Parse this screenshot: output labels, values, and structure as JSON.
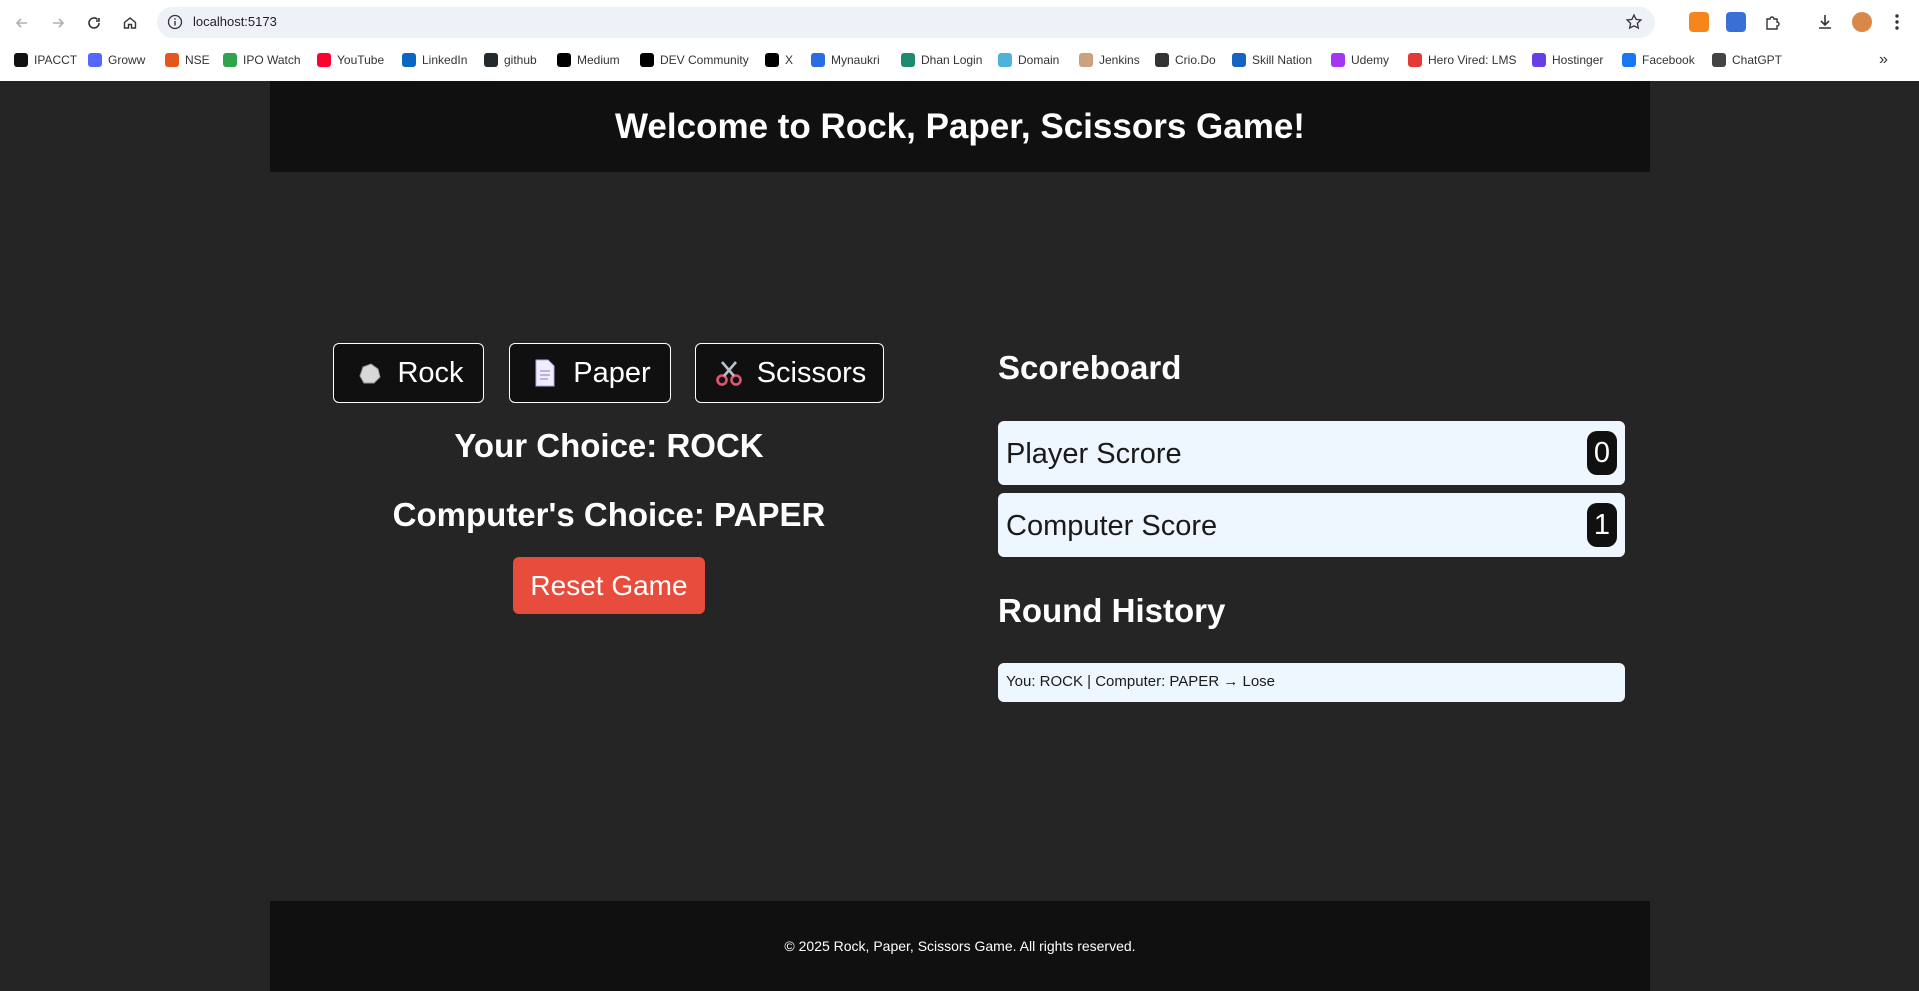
{
  "browser": {
    "url": "localhost:5173",
    "bookmarks": [
      {
        "label": "IPACCT",
        "icon": "ipacct-icon",
        "color": "#111111"
      },
      {
        "label": "Groww",
        "icon": "groww-icon",
        "color": "#5367ff"
      },
      {
        "label": "NSE",
        "icon": "nse-icon",
        "color": "#e2571e"
      },
      {
        "label": "IPO Watch",
        "icon": "ipo-watch-icon",
        "color": "#2ea44f"
      },
      {
        "label": "YouTube",
        "icon": "youtube-icon",
        "color": "#ff0033"
      },
      {
        "label": "LinkedIn",
        "icon": "linkedin-icon",
        "color": "#0a66c2"
      },
      {
        "label": "github",
        "icon": "github-icon",
        "color": "#24292f"
      },
      {
        "label": "Medium",
        "icon": "medium-icon",
        "color": "#000000"
      },
      {
        "label": "DEV Community",
        "icon": "dev-icon",
        "color": "#000000"
      },
      {
        "label": "X",
        "icon": "x-icon",
        "color": "#000000"
      },
      {
        "label": "Mynaukri",
        "icon": "mynaukri-icon",
        "color": "#2d6be4"
      },
      {
        "label": "Dhan Login",
        "icon": "dhan-icon",
        "color": "#1f8a70"
      },
      {
        "label": "Domain",
        "icon": "domain-icon",
        "color": "#4fb3d9"
      },
      {
        "label": "Jenkins",
        "icon": "jenkins-icon",
        "color": "#c9a27e"
      },
      {
        "label": "Crio.Do",
        "icon": "crio-icon",
        "color": "#333333"
      },
      {
        "label": "Skill Nation",
        "icon": "skill-nation-icon",
        "color": "#1565c0"
      },
      {
        "label": "Udemy",
        "icon": "udemy-icon",
        "color": "#a435f0"
      },
      {
        "label": "Hero Vired: LMS",
        "icon": "hero-vired-icon",
        "color": "#e53935"
      },
      {
        "label": "Hostinger",
        "icon": "hostinger-icon",
        "color": "#673de6"
      },
      {
        "label": "Facebook",
        "icon": "facebook-icon",
        "color": "#1877f2"
      },
      {
        "label": "ChatGPT",
        "icon": "chatgpt-icon",
        "color": "#444444"
      }
    ]
  },
  "app": {
    "title": "Welcome to Rock, Paper, Scissors Game!",
    "choices": [
      {
        "label": "Rock",
        "icon": "rock-icon"
      },
      {
        "label": "Paper",
        "icon": "paper-icon"
      },
      {
        "label": "Scissors",
        "icon": "scissors-icon"
      }
    ],
    "your_choice": "Your Choice: ROCK",
    "computer_choice": "Computer's Choice: PAPER",
    "reset_label": "Reset Game",
    "scoreboard": {
      "title": "Scoreboard",
      "player_label": "Player Scrore",
      "player_score": "0",
      "computer_label": "Computer Score",
      "computer_score": "1"
    },
    "history": {
      "title": "Round History",
      "items": [
        "You: ROCK | Computer: PAPER → Lose"
      ]
    },
    "footer": "© 2025 Rock, Paper, Scissors Game. All rights reserved."
  },
  "colors": {
    "page_bg": "#252525",
    "header_bg": "#101010",
    "reset_accent": "#e74c3c",
    "score_card_bg": "#eef6ff"
  }
}
